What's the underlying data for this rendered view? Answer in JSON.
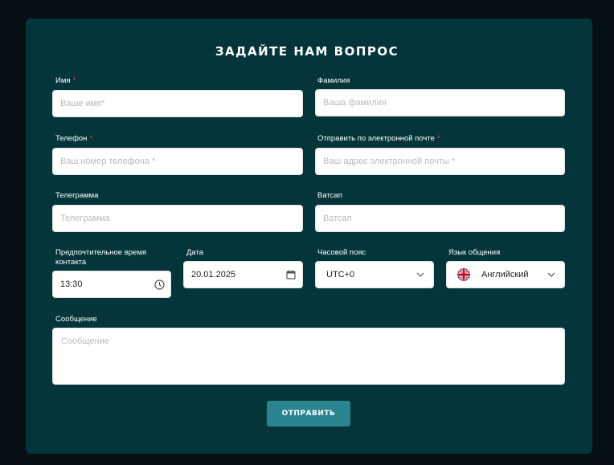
{
  "form": {
    "title": "ЗАДАЙТЕ НАМ ВОПРОС",
    "first_name": {
      "label": "Имя",
      "required": "*",
      "placeholder": "Ваше имя*"
    },
    "last_name": {
      "label": "Фамилия",
      "placeholder": "Ваша фамилия"
    },
    "phone": {
      "label": "Телефон",
      "required": "*",
      "placeholder": "Ваш номер телефона *"
    },
    "email": {
      "label": "Отправить по электронной почте",
      "required": "*",
      "placeholder": "Ваш адрес электронной почты *"
    },
    "telegram": {
      "label": "Телеграмма",
      "placeholder": "Телеграмма"
    },
    "whatsapp": {
      "label": "Ватсап",
      "placeholder": "Ватсап"
    },
    "preferred_time": {
      "label_line1": "Предпочтительное время",
      "label_line2": "контакта",
      "value": "13:30"
    },
    "date": {
      "label": "Дата",
      "value": "20.01.2025"
    },
    "timezone": {
      "label": "Часовой пояс",
      "value": "UTC+0"
    },
    "language": {
      "label": "Язык общения",
      "value": "Английский"
    },
    "message": {
      "label": "Сообщение",
      "placeholder": "Сообщение"
    },
    "submit_label": "ОТПРАВИТЬ"
  },
  "colors": {
    "page_bg": "#050f14",
    "card_bg": "#03353a",
    "accent": "#2a8590",
    "required": "#ff4040"
  },
  "icons": {
    "time": "clock-icon",
    "date": "calendar-icon",
    "dropdown": "chevron-down-icon",
    "language_flag": "uk-flag-icon"
  }
}
